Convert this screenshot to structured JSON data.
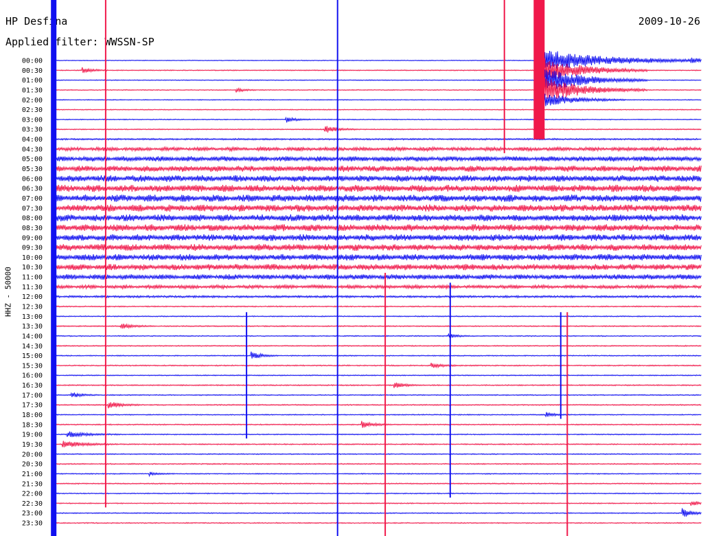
{
  "header": {
    "station": "HP Desfina",
    "filter_label": "Applied filter: WWSSN-SP",
    "date": "2009-10-26",
    "channel_label": "HHZ - 50000"
  },
  "colors": {
    "even_trace": "#1010f0",
    "odd_trace": "#f0184a",
    "label": "#000000"
  },
  "chart_data": {
    "type": "line",
    "title": "HP Desfina",
    "subtitle": "Applied filter: WWSSN-SP",
    "date": "2009-10-26",
    "ylabel": "HHZ - 50000",
    "grid": false,
    "legend": "none",
    "trace_minutes": 30,
    "trace_colors": [
      "#1010f0",
      "#f0184a"
    ],
    "rows": [
      {
        "label": "00:00",
        "noise": 0.35
      },
      {
        "label": "00:30",
        "noise": 0.4
      },
      {
        "label": "01:00",
        "noise": 0.35
      },
      {
        "label": "01:30",
        "noise": 0.4
      },
      {
        "label": "02:00",
        "noise": 0.35
      },
      {
        "label": "02:30",
        "noise": 0.4
      },
      {
        "label": "03:00",
        "noise": 0.4
      },
      {
        "label": "03:30",
        "noise": 0.45
      },
      {
        "label": "04:00",
        "noise": 0.7
      },
      {
        "label": "04:30",
        "noise": 1.6
      },
      {
        "label": "05:00",
        "noise": 2.2
      },
      {
        "label": "05:30",
        "noise": 2.6
      },
      {
        "label": "06:00",
        "noise": 2.8
      },
      {
        "label": "06:30",
        "noise": 3.0
      },
      {
        "label": "07:00",
        "noise": 3.0
      },
      {
        "label": "07:30",
        "noise": 3.0
      },
      {
        "label": "08:00",
        "noise": 2.9
      },
      {
        "label": "08:30",
        "noise": 2.9
      },
      {
        "label": "09:00",
        "noise": 2.8
      },
      {
        "label": "09:30",
        "noise": 2.8
      },
      {
        "label": "10:00",
        "noise": 2.7
      },
      {
        "label": "10:30",
        "noise": 2.6
      },
      {
        "label": "11:00",
        "noise": 2.2
      },
      {
        "label": "11:30",
        "noise": 1.5
      },
      {
        "label": "12:00",
        "noise": 0.9
      },
      {
        "label": "12:30",
        "noise": 0.5
      },
      {
        "label": "13:00",
        "noise": 0.45
      },
      {
        "label": "13:30",
        "noise": 0.5
      },
      {
        "label": "14:00",
        "noise": 0.45
      },
      {
        "label": "14:30",
        "noise": 0.5
      },
      {
        "label": "15:00",
        "noise": 0.45
      },
      {
        "label": "15:30",
        "noise": 0.5
      },
      {
        "label": "16:00",
        "noise": 0.45
      },
      {
        "label": "16:30",
        "noise": 0.5
      },
      {
        "label": "17:00",
        "noise": 0.45
      },
      {
        "label": "17:30",
        "noise": 0.5
      },
      {
        "label": "18:00",
        "noise": 0.45
      },
      {
        "label": "18:30",
        "noise": 0.5
      },
      {
        "label": "19:00",
        "noise": 0.45
      },
      {
        "label": "19:30",
        "noise": 0.5
      },
      {
        "label": "20:00",
        "noise": 0.45
      },
      {
        "label": "20:30",
        "noise": 0.5
      },
      {
        "label": "21:00",
        "noise": 0.45
      },
      {
        "label": "21:30",
        "noise": 0.5
      },
      {
        "label": "22:00",
        "noise": 0.45
      },
      {
        "label": "22:30",
        "noise": 0.45
      },
      {
        "label": "23:00",
        "noise": 0.45
      },
      {
        "label": "23:30",
        "noise": 0.45
      }
    ],
    "events": [
      {
        "row": 1,
        "minute": 1.4,
        "amp": 3,
        "dur": 1.2
      },
      {
        "row": 3,
        "minute": 8.5,
        "amp": 2.2,
        "dur": 1
      },
      {
        "row": 6,
        "minute": 10.8,
        "amp": 3,
        "dur": 1.2
      },
      {
        "row": 7,
        "minute": 12.6,
        "amp": 4,
        "dur": 1.5
      },
      {
        "row": 0,
        "minute": 22.5,
        "amp": 12,
        "dur": 8
      },
      {
        "row": 1,
        "minute": 22.5,
        "amp": 14,
        "dur": 5
      },
      {
        "row": 2,
        "minute": 22.5,
        "amp": 14,
        "dur": 5
      },
      {
        "row": 3,
        "minute": 22.5,
        "amp": 14,
        "dur": 5
      },
      {
        "row": 4,
        "minute": 22.5,
        "amp": 8,
        "dur": 4
      },
      {
        "row": 0,
        "minute": 29.5,
        "amp": 2.5,
        "dur": 1
      },
      {
        "row": 27,
        "minute": 3.2,
        "amp": 2.5,
        "dur": 1.5
      },
      {
        "row": 30,
        "minute": 9.2,
        "amp": 4,
        "dur": 1.2
      },
      {
        "row": 33,
        "minute": 15.8,
        "amp": 3,
        "dur": 1.2
      },
      {
        "row": 35,
        "minute": 2.6,
        "amp": 4,
        "dur": 1.5
      },
      {
        "row": 34,
        "minute": 0.9,
        "amp": 3,
        "dur": 1.2
      },
      {
        "row": 37,
        "minute": 14.3,
        "amp": 3.5,
        "dur": 1.4
      },
      {
        "row": 38,
        "minute": 0.7,
        "amp": 3,
        "dur": 2.5
      },
      {
        "row": 39,
        "minute": 0.5,
        "amp": 3.5,
        "dur": 2.5
      },
      {
        "row": 42,
        "minute": 4.5,
        "amp": 2,
        "dur": 1
      },
      {
        "row": 45,
        "minute": 29.5,
        "amp": 3,
        "dur": 1
      },
      {
        "row": 46,
        "minute": 29.1,
        "amp": 5,
        "dur": 1.2
      },
      {
        "row": 28,
        "minute": 18.3,
        "amp": 2.5,
        "dur": 1
      },
      {
        "row": 31,
        "minute": 17.5,
        "amp": 3,
        "dur": 1.2
      },
      {
        "row": 36,
        "minute": 22.8,
        "amp": 2.5,
        "dur": 1
      }
    ],
    "spikes": [
      {
        "minute": 0.1,
        "from": 0,
        "to": 47,
        "style": "band"
      },
      {
        "minute": 2.5,
        "from": 0,
        "to": 45
      },
      {
        "minute": 13.2,
        "from": 0,
        "to": 47
      },
      {
        "minute": 15.4,
        "from": 22,
        "to": 47
      },
      {
        "minute": 18.4,
        "from": 23,
        "to": 44
      },
      {
        "minute": 23.8,
        "from": 26,
        "to": 47
      },
      {
        "minute": 23.5,
        "from": 26,
        "to": 36
      },
      {
        "minute": 20.9,
        "from": 0,
        "to": 9
      },
      {
        "minute": 9.0,
        "from": 26,
        "to": 38
      }
    ]
  }
}
